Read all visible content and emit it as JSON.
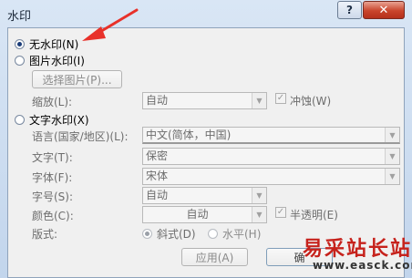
{
  "window": {
    "title": "水印",
    "help_label": "?",
    "close_label": "✕"
  },
  "no_watermark": {
    "label": "无水印(N)",
    "selected": true
  },
  "picture_watermark": {
    "label": "图片水印(I)",
    "select_button": "选择图片(P)...",
    "scale_label": "缩放(L):",
    "scale_value": "自动",
    "washout_label": "冲蚀(W)",
    "washout_checked": true
  },
  "text_watermark": {
    "label": "文字水印(X)",
    "language_label": "语言(国家/地区)(L):",
    "language_value": "中文(简体，中国)",
    "text_label": "文字(T):",
    "text_value": "保密",
    "font_label": "字体(F):",
    "font_value": "宋体",
    "size_label": "字号(S):",
    "size_value": "自动",
    "color_label": "颜色(C):",
    "color_value": "自动",
    "semitransparent_label": "半透明(E)",
    "semitransparent_checked": true,
    "layout_label": "版式:",
    "diagonal_label": "斜式(D)",
    "horizontal_label": "水平(H)",
    "layout_selected": "diagonal"
  },
  "buttons": {
    "apply": "应用(A)",
    "ok": "确"
  },
  "overlay": {
    "watermark_text": "易采站长站",
    "watermark_url": "www.easck.com"
  },
  "colors": {
    "annotation_arrow": "#e8312a",
    "overlay_text": "#c6221c"
  }
}
